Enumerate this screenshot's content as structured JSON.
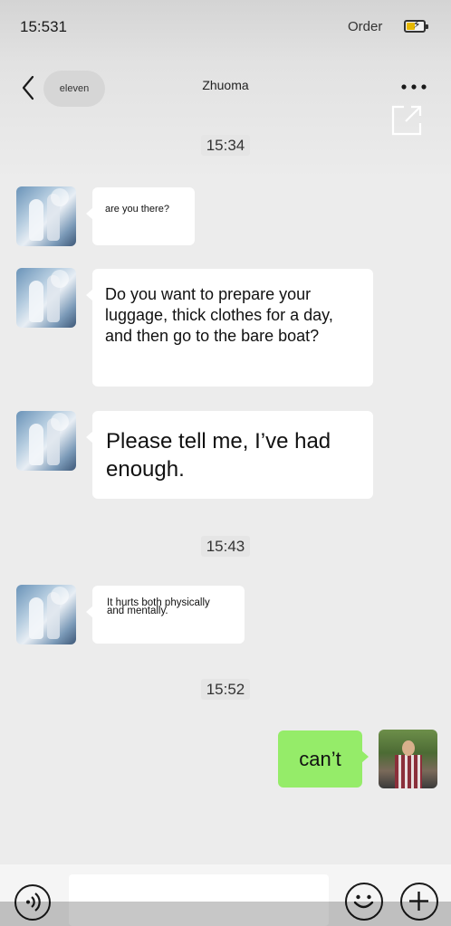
{
  "status_bar": {
    "time": "15:531",
    "carrier": "Order",
    "battery_charging": true
  },
  "nav": {
    "back_label": "eleven",
    "title": "Zhuoma"
  },
  "messages": {
    "ts1": "15:34",
    "m1": "are you there?",
    "m2": "Do you want to prepare your luggage, thick clothes for a day, and then go to the bare boat?",
    "m3": "Please tell me, I’ve had enough.",
    "ts2": "15:43",
    "m4": "It hurts both physically and mentally.",
    "ts3": "15:52",
    "my1": "can’t"
  },
  "input": {
    "value": ""
  },
  "icons": [
    "back-icon",
    "more-icon",
    "share-icon",
    "voice-icon",
    "emoji-icon",
    "plus-icon"
  ],
  "colors": {
    "sent_bubble": "#95ec69",
    "received_bubble": "#ffffff",
    "background": "#ececec"
  }
}
